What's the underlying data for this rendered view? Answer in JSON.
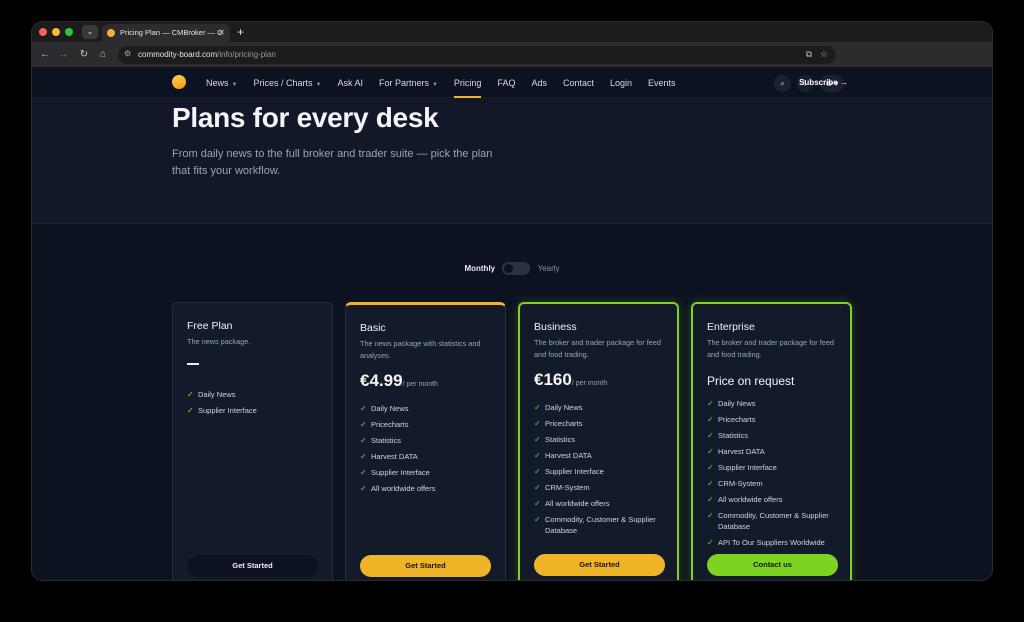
{
  "browser": {
    "tab_title": "Pricing Plan — CMBroker — C",
    "tab_menu_icon": "chevron-down-icon",
    "new_tab": "+",
    "url_host": "commodity-board.com",
    "url_path": "/info/pricing-plan",
    "traffic_colors": [
      "#ff5f57",
      "#febc2e",
      "#28c840"
    ]
  },
  "nav": {
    "items": [
      {
        "label": "News",
        "dropdown": true
      },
      {
        "label": "Prices / Charts",
        "dropdown": true
      },
      {
        "label": "Ask AI",
        "dropdown": false
      },
      {
        "label": "For Partners",
        "dropdown": true
      },
      {
        "label": "Pricing",
        "dropdown": false,
        "active": true
      },
      {
        "label": "FAQ",
        "dropdown": false
      },
      {
        "label": "Ads",
        "dropdown": false
      },
      {
        "label": "Contact",
        "dropdown": false
      },
      {
        "label": "Login",
        "dropdown": false
      },
      {
        "label": "Events",
        "dropdown": false
      }
    ],
    "subscribe_label": "Subscribe"
  },
  "hero": {
    "title": "Plans for every desk",
    "subtitle": "From daily news to the full broker and trader suite — pick the plan that fits your workflow."
  },
  "billing_toggle": {
    "left": "Monthly",
    "right": "Yearly"
  },
  "plans": [
    {
      "name": "Free Plan",
      "description": "The news package.",
      "price": "—",
      "features": [
        "Daily News",
        "Supplier Interface"
      ],
      "button": "Get Started"
    },
    {
      "name": "Basic",
      "description": "The news package with statistics and analyses.",
      "price": "€4.99",
      "per": "/ per month",
      "features": [
        "Daily News",
        "Pricecharts",
        "Statistics",
        "Harvest DATA",
        "Supplier Interface",
        "All worldwide offers"
      ],
      "button": "Get Started"
    },
    {
      "name": "Business",
      "description": "The broker and trader package for feed and food trading.",
      "price": "€160",
      "per": "/ per month",
      "features": [
        "Daily News",
        "Pricecharts",
        "Statistics",
        "Harvest DATA",
        "Supplier Interface",
        "CRM-System",
        "All worldwide offers",
        "Commodity, Customer & Supplier Database"
      ],
      "button": "Get Started"
    },
    {
      "name": "Enterprise",
      "description": "The broker and trader package for feed and food trading.",
      "price": "Price on request",
      "features": [
        "Daily News",
        "Pricecharts",
        "Statistics",
        "Harvest DATA",
        "Supplier Interface",
        "CRM-System",
        "All worldwide offers",
        "Commodity, Customer & Supplier Database",
        "API To Our Suppliers Worldwide"
      ],
      "button": "Contact us"
    }
  ],
  "colors": {
    "accent_yellow": "#f0b429",
    "accent_green": "#7ed321",
    "background": "#0d1220"
  }
}
